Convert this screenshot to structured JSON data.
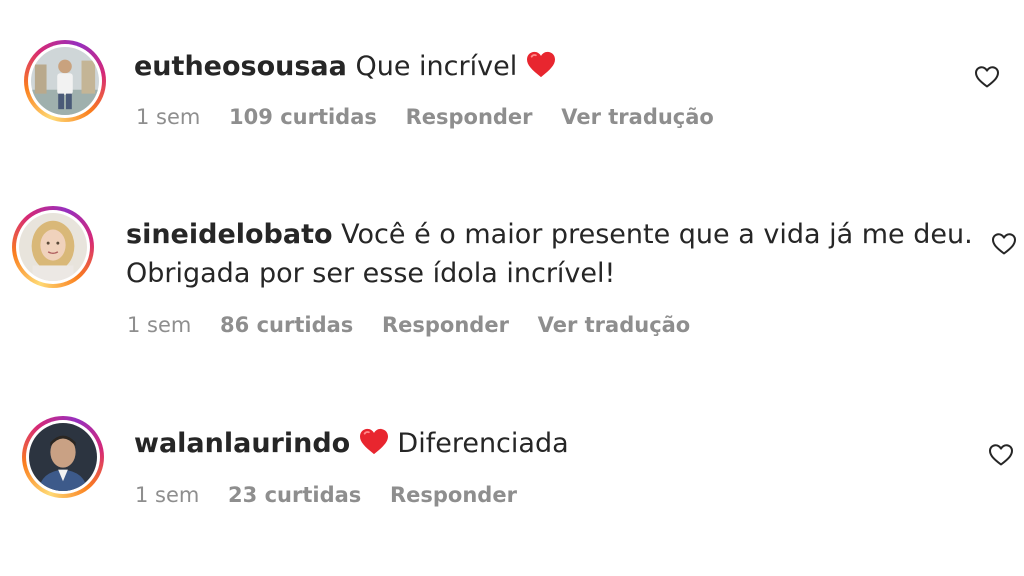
{
  "comments": [
    {
      "username": "eutheosousaa",
      "text": "Que incrível",
      "emoji": "red-heart",
      "time": "1 sem",
      "likes": "109 curtidas",
      "reply": "Responder",
      "translate": "Ver tradução"
    },
    {
      "username": "sineidelobato",
      "text": "Você é o maior presente que a vida já me deu.",
      "text2": "Obrigada por ser esse ídola incrível!",
      "time": "1 sem",
      "likes": "86 curtidas",
      "reply": "Responder",
      "translate": "Ver tradução"
    },
    {
      "username": "walanlaurindo",
      "emoji": "red-heart",
      "text": "Diferenciada",
      "time": "1 sem",
      "likes": "23 curtidas",
      "reply": "Responder"
    }
  ],
  "colors": {
    "text": "#262626",
    "secondary": "#8e8e8e",
    "heart": "#ed4956"
  }
}
